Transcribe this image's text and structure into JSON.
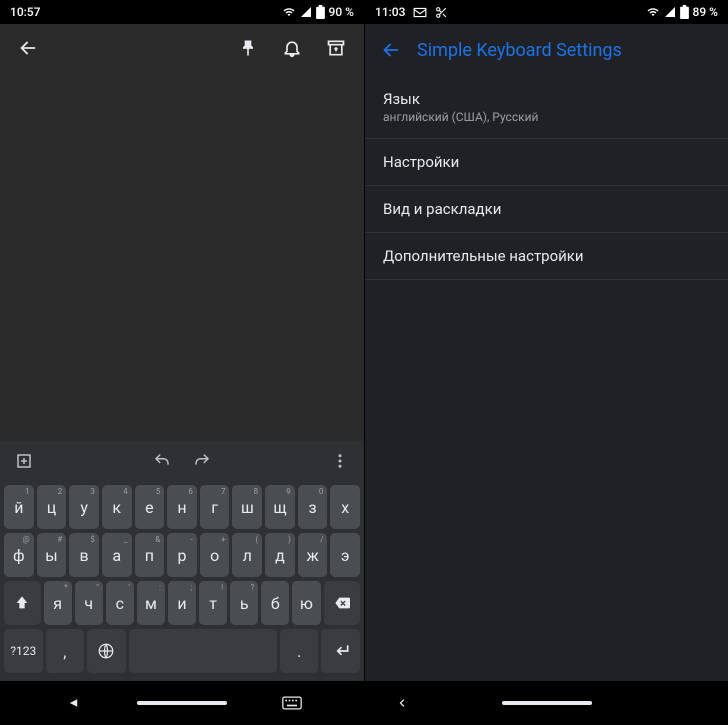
{
  "left": {
    "status": {
      "time": "10:57",
      "battery_pct": "90 %"
    },
    "keyboard": {
      "symbols_label": "?123",
      "rows": [
        [
          "й",
          "ц",
          "у",
          "к",
          "е",
          "н",
          "г",
          "ш",
          "щ",
          "з",
          "х"
        ],
        [
          "ф",
          "ы",
          "в",
          "а",
          "п",
          "р",
          "о",
          "л",
          "д",
          "ж",
          "э"
        ],
        [
          "я",
          "ч",
          "с",
          "м",
          "и",
          "т",
          "ь",
          "б",
          "ю"
        ]
      ],
      "hints_row1": [
        "1",
        "2",
        "3",
        "4",
        "5",
        "6",
        "7",
        "8",
        "9",
        "0",
        ""
      ],
      "hints_row2": [
        "@",
        "#",
        "$",
        "_",
        "&",
        "-",
        "+",
        "(",
        ")",
        "/",
        ""
      ],
      "hints_row3": [
        "*",
        "\"",
        "'",
        ":",
        ";",
        "!",
        "?",
        "",
        ""
      ]
    }
  },
  "right": {
    "status": {
      "time": "11:03",
      "battery_pct": "89 %"
    },
    "title": "Simple Keyboard Settings",
    "items": [
      {
        "primary": "Язык",
        "secondary": "английский (США), Русский"
      },
      {
        "primary": "Настройки",
        "secondary": ""
      },
      {
        "primary": "Вид и раскладки",
        "secondary": ""
      },
      {
        "primary": "Дополнительные настройки",
        "secondary": ""
      }
    ]
  }
}
